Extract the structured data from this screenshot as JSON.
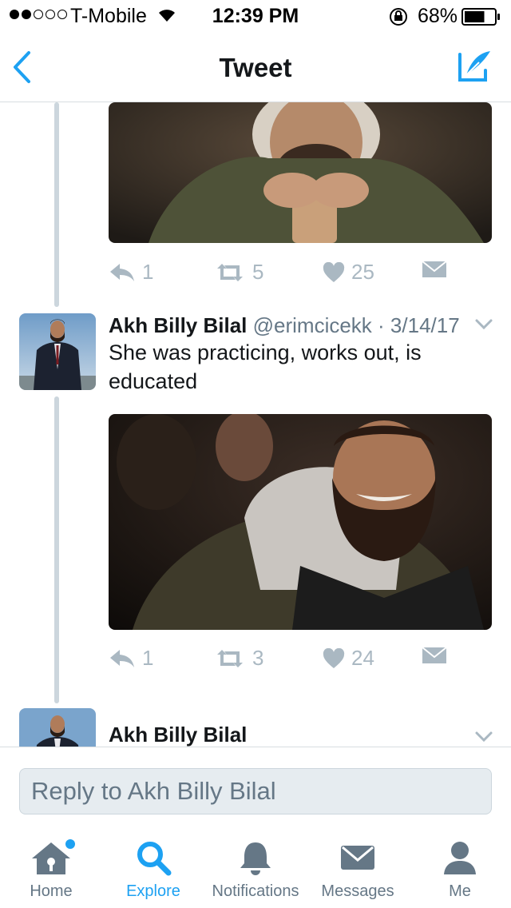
{
  "status_bar": {
    "carrier": "T-Mobile",
    "signal_bars": 2,
    "time": "12:39 PM",
    "battery_percent": "68%",
    "battery_level": 0.68
  },
  "nav": {
    "title": "Tweet",
    "back_icon": "chevron-left-icon",
    "compose_icon": "compose-tweet-icon"
  },
  "tweets": [
    {
      "reply_count": "1",
      "retweet_count": "5",
      "like_count": "25"
    },
    {
      "author_name": "Akh Billy Bilal",
      "handle": "@erimcicekk",
      "date": "· 3/14/17",
      "text": "She was practicing, works out, is educated",
      "reply_count": "1",
      "retweet_count": "3",
      "like_count": "24"
    },
    {
      "author_name": "Akh Billy Bilal"
    }
  ],
  "reply": {
    "placeholder": "Reply to Akh Billy Bilal"
  },
  "tabs": [
    {
      "label": "Home",
      "icon": "home-icon",
      "has_badge": true
    },
    {
      "label": "Explore",
      "icon": "search-icon",
      "active": true
    },
    {
      "label": "Notifications",
      "icon": "bell-icon"
    },
    {
      "label": "Messages",
      "icon": "envelope-icon"
    },
    {
      "label": "Me",
      "icon": "person-icon"
    }
  ],
  "colors": {
    "accent": "#1da1f2",
    "icon_gray": "#aab8c2",
    "text_secondary": "#657786",
    "divider": "#ccd6dd"
  }
}
